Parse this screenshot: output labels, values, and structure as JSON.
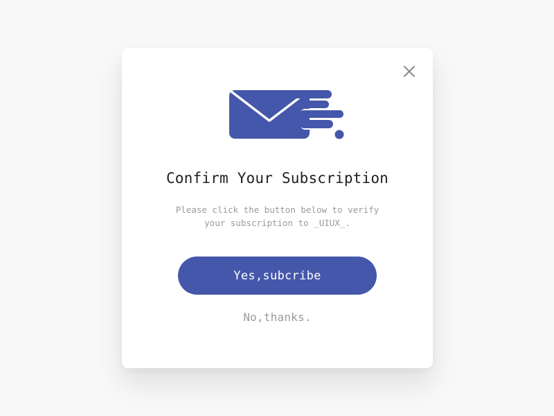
{
  "modal": {
    "title": "Confirm Your Subscription",
    "description_line1": "Please click the button below to verify",
    "description_line2": "your subscription to _UIUX_.",
    "primary_button_label": "Yes,subcribe",
    "secondary_link_label": "No,thanks.",
    "icons": {
      "close": "close-icon",
      "hero": "mail-send-icon"
    }
  },
  "colors": {
    "accent": "#4557aa",
    "background": "#f8f8f8",
    "card": "#ffffff",
    "title_text": "#1e1e1e",
    "muted_text": "#9a9a9a"
  }
}
